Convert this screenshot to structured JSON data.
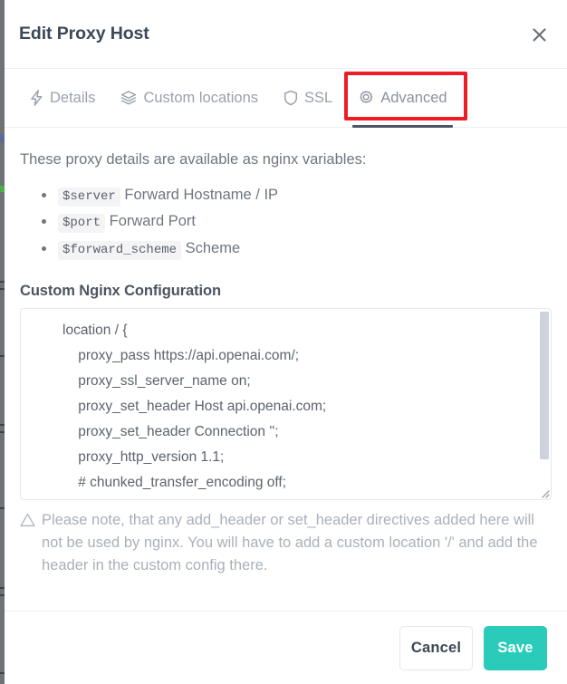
{
  "modal": {
    "title": "Edit Proxy Host",
    "close_icon": "close-icon"
  },
  "tabs": [
    {
      "label": "Details",
      "icon": "bolt-icon",
      "active": false
    },
    {
      "label": "Custom locations",
      "icon": "layers-icon",
      "active": false
    },
    {
      "label": "SSL",
      "icon": "shield-icon",
      "active": false
    },
    {
      "label": "Advanced",
      "icon": "gear-icon",
      "active": true
    }
  ],
  "highlight": {
    "target_tab": "Advanced",
    "color": "#ee1c25"
  },
  "body": {
    "intro": "These proxy details are available as nginx variables:",
    "variables": [
      {
        "name": "$server",
        "description": "Forward Hostname / IP"
      },
      {
        "name": "$port",
        "description": "Forward Port"
      },
      {
        "name": "$forward_scheme",
        "description": "Scheme"
      }
    ],
    "config_label": "Custom Nginx Configuration",
    "config_value": "location / {\n    proxy_pass https://api.openai.com/;\n    proxy_ssl_server_name on;\n    proxy_set_header Host api.openai.com;\n    proxy_set_header Connection '';\n    proxy_http_version 1.1;\n    # chunked_transfer_encoding off;\n    proxy_buffering off;\n    proxy_cache off;\n}",
    "config_placeholder": "",
    "note_icon": "warning-triangle-icon",
    "note": "Please note, that any add_header or set_header directives added here will not be used by nginx. You will have to add a custom location '/' and add the header in the custom config there."
  },
  "footer": {
    "cancel_label": "Cancel",
    "save_label": "Save",
    "save_color": "#2bcbba"
  }
}
